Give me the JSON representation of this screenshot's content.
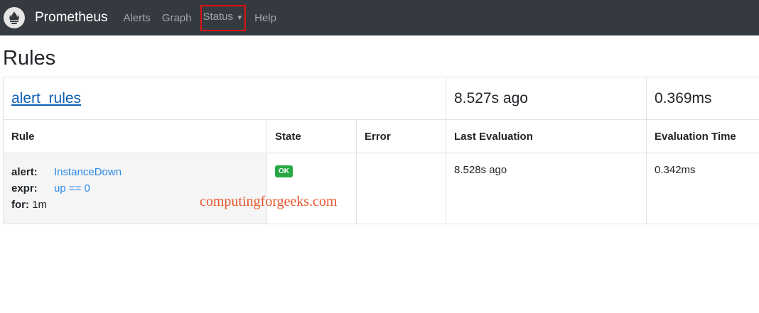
{
  "nav": {
    "brand": "Prometheus",
    "links": [
      "Alerts",
      "Graph",
      "Status",
      "Help"
    ]
  },
  "page_title": "Rules",
  "group": {
    "name": "alert_rules",
    "last_eval": "8.527s ago",
    "eval_time": "0.369ms"
  },
  "headers": [
    "Rule",
    "State",
    "Error",
    "Last Evaluation",
    "Evaluation Time"
  ],
  "rule": {
    "alert_label": "alert:",
    "alert": "InstanceDown",
    "expr_label": "expr:",
    "expr": "up == 0",
    "for_label": "for:",
    "for": "1m",
    "state": "OK",
    "error": "",
    "last_eval": "8.528s ago",
    "eval_time": "0.342ms"
  },
  "watermark": "computingforgeeks.com"
}
